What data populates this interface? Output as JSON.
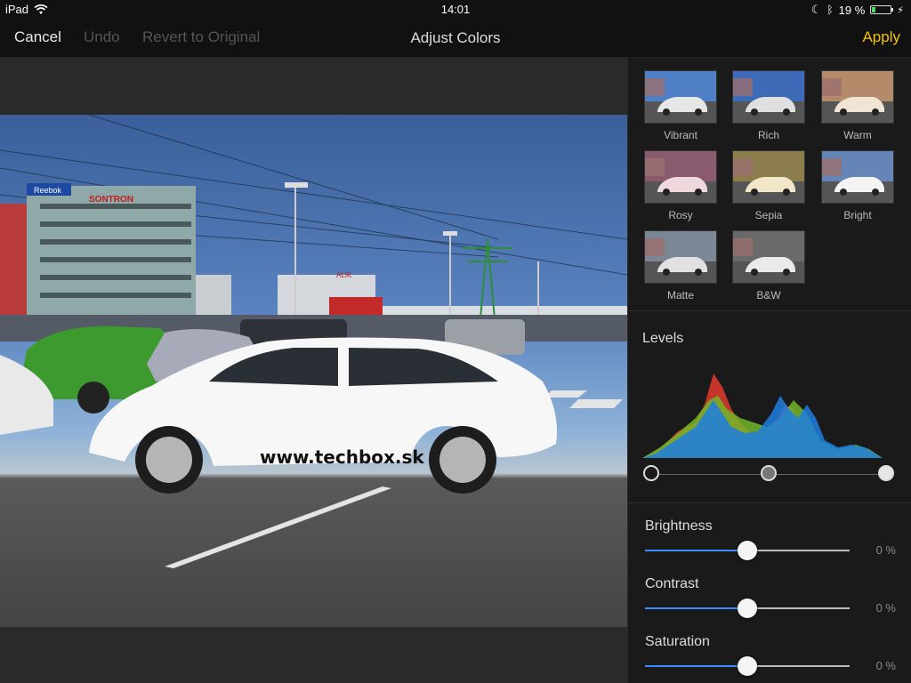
{
  "status": {
    "device": "iPad",
    "time": "14:01",
    "battery_percent": "19 %",
    "battery_level": 0.19,
    "icons": [
      "wifi-icon",
      "moon-icon",
      "bluetooth-icon",
      "battery-icon",
      "charging-icon"
    ]
  },
  "nav": {
    "cancel": "Cancel",
    "undo": "Undo",
    "revert": "Revert to Original",
    "title": "Adjust Colors",
    "apply": "Apply"
  },
  "photo": {
    "watermark": "www.techbox.sk",
    "signs": [
      "Reebok",
      "SONTRON",
      "ALIK"
    ]
  },
  "filters": [
    "Vibrant",
    "Rich",
    "Warm",
    "Rosy",
    "Sepia",
    "Bright",
    "Matte",
    "B&W"
  ],
  "levels": {
    "title": "Levels",
    "black_point": 0.0,
    "midpoint": 0.5,
    "white_point": 1.0
  },
  "adjustments": [
    {
      "label": "Brightness",
      "value": "0 %",
      "level": 0.5
    },
    {
      "label": "Contrast",
      "value": "0 %",
      "level": 0.5
    },
    {
      "label": "Saturation",
      "value": "0 %",
      "level": 0.5
    }
  ],
  "colors": {
    "accent": "#f5c400",
    "slider_fill": "#3a8dff"
  }
}
